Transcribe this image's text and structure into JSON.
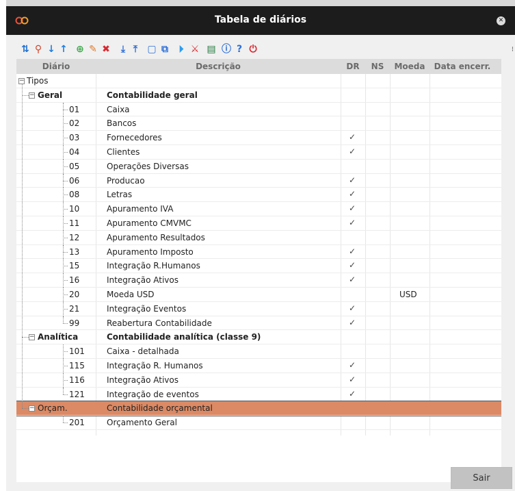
{
  "window": {
    "title": "Tabela de diários"
  },
  "toolbar": {
    "icons": [
      "sort-icon",
      "search-icon",
      "arrow-down-icon",
      "arrow-up-icon",
      "add-icon",
      "edit-icon",
      "delete-icon",
      "export-icon",
      "import-icon",
      "copy-icon",
      "duplicate-icon",
      "run-icon",
      "remove-data-icon",
      "excel-icon",
      "info-icon",
      "help-icon",
      "power-icon"
    ]
  },
  "columns": {
    "diario": "Diário",
    "descricao": "Descrição",
    "dr": "DR",
    "ns": "NS",
    "moeda": "Moeda",
    "data_encerr": "Data encerr."
  },
  "tree": {
    "root": "Tipos",
    "groups": [
      {
        "code": "Geral",
        "desc": "Contabilidade geral",
        "selected": false,
        "items": [
          {
            "code": "01",
            "desc": "Caixa",
            "dr": false,
            "moeda": ""
          },
          {
            "code": "02",
            "desc": "Bancos",
            "dr": false,
            "moeda": ""
          },
          {
            "code": "03",
            "desc": "Fornecedores",
            "dr": true,
            "moeda": ""
          },
          {
            "code": "04",
            "desc": "Clientes",
            "dr": true,
            "moeda": ""
          },
          {
            "code": "05",
            "desc": "Operações Diversas",
            "dr": false,
            "moeda": ""
          },
          {
            "code": "06",
            "desc": "Producao",
            "dr": true,
            "moeda": ""
          },
          {
            "code": "08",
            "desc": "Letras",
            "dr": true,
            "moeda": ""
          },
          {
            "code": "10",
            "desc": "Apuramento IVA",
            "dr": true,
            "moeda": ""
          },
          {
            "code": "11",
            "desc": "Apuramento CMVMC",
            "dr": true,
            "moeda": ""
          },
          {
            "code": "12",
            "desc": "Apuramento Resultados",
            "dr": false,
            "moeda": ""
          },
          {
            "code": "13",
            "desc": "Apuramento Imposto",
            "dr": true,
            "moeda": ""
          },
          {
            "code": "15",
            "desc": "Integração R.Humanos",
            "dr": true,
            "moeda": ""
          },
          {
            "code": "16",
            "desc": "Integração Ativos",
            "dr": true,
            "moeda": ""
          },
          {
            "code": "20",
            "desc": "Moeda USD",
            "dr": false,
            "moeda": "USD"
          },
          {
            "code": "21",
            "desc": "Integração Eventos",
            "dr": true,
            "moeda": ""
          },
          {
            "code": "99",
            "desc": "Reabertura Contabilidade",
            "dr": true,
            "moeda": ""
          }
        ]
      },
      {
        "code": "Analítica",
        "desc": "Contabilidade analítica (classe 9)",
        "selected": false,
        "items": [
          {
            "code": "101",
            "desc": "Caixa - detalhada",
            "dr": false,
            "moeda": ""
          },
          {
            "code": "115",
            "desc": "Integração R. Humanos",
            "dr": true,
            "moeda": ""
          },
          {
            "code": "116",
            "desc": "Integração Ativos",
            "dr": true,
            "moeda": ""
          },
          {
            "code": "121",
            "desc": "Integração de eventos",
            "dr": true,
            "moeda": ""
          }
        ]
      },
      {
        "code": "Orçam.",
        "desc": "Contabilidade orçamental",
        "selected": true,
        "items": [
          {
            "code": "201",
            "desc": "Orçamento Geral",
            "dr": false,
            "moeda": ""
          }
        ]
      }
    ]
  },
  "check_mark": "✓",
  "buttons": {
    "sair": "Sair"
  },
  "colors": {
    "titlebar": "#1c1c1c",
    "selected_row": "#db8a65",
    "header": "#dcdcdc"
  }
}
